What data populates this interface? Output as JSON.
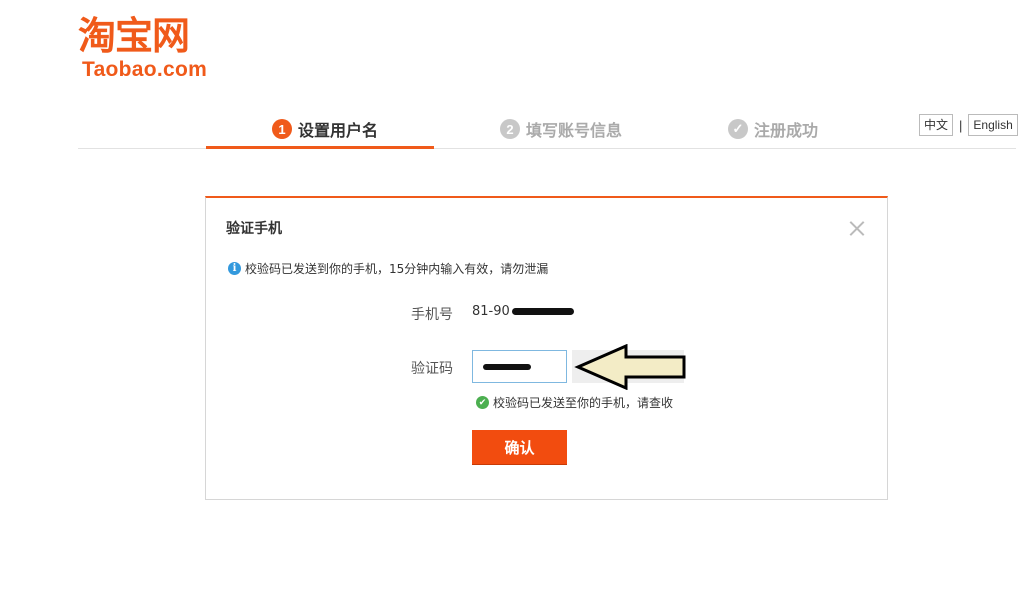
{
  "logo": {
    "cn": "淘宝网",
    "en": "Taobao.com"
  },
  "steps": [
    {
      "num": "1",
      "label": "设置用户名",
      "state": "active"
    },
    {
      "num": "2",
      "label": "填写账号信息",
      "state": "inactive"
    },
    {
      "num": "✓",
      "label": "注册成功",
      "state": "inactive"
    }
  ],
  "lang": {
    "cn": "中文",
    "separator": "|",
    "en": "English"
  },
  "dialog": {
    "title": "验证手机",
    "info": "校验码已发送到你的手机，15分钟内输入有效，请勿泄漏",
    "phone_label": "手机号",
    "phone_value": "81-90",
    "code_label": "验证码",
    "code_sent_msg": "校验码已发送至你的手机，请查收",
    "confirm_label": "确认"
  },
  "colors": {
    "accent": "#f05a1a",
    "button": "#f24c0f",
    "info": "#3399dd",
    "success": "#4caf50",
    "arrow_fill": "#f3ecc6"
  },
  "icons": {
    "info": "info-icon",
    "check": "check-circle-icon",
    "close": "close-icon",
    "arrow": "left-arrow-icon"
  }
}
